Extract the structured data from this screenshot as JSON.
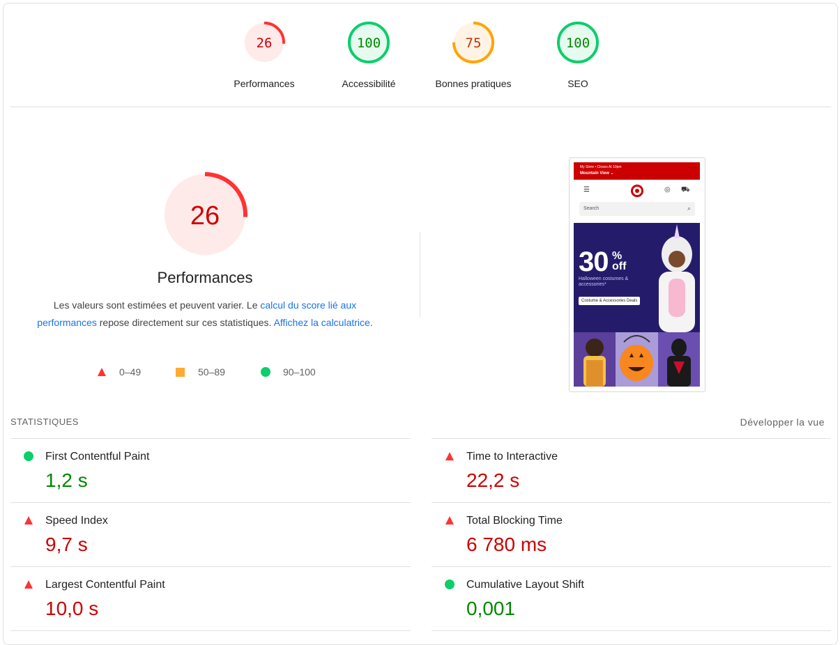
{
  "categories": [
    {
      "score": "26",
      "label": "Performances",
      "fraction": 0.26,
      "status": "fail"
    },
    {
      "score": "100",
      "label": "Accessibilité",
      "fraction": 1.0,
      "status": "pass"
    },
    {
      "score": "75",
      "label": "Bonnes pratiques",
      "fraction": 0.75,
      "status": "average"
    },
    {
      "score": "100",
      "label": "SEO",
      "fraction": 1.0,
      "status": "pass"
    }
  ],
  "performance": {
    "score": "26",
    "fraction": 0.26,
    "title": "Performances",
    "desc_pre": "Les valeurs sont estimées et peuvent varier. Le ",
    "desc_link1": "calcul du score lié aux performances",
    "desc_mid": " repose directement sur ces statistiques. ",
    "desc_link2": "Affichez la calculatrice",
    "desc_post": "."
  },
  "legend": [
    {
      "shape": "triangle",
      "color": "#ff3333",
      "range": "0–49"
    },
    {
      "shape": "square",
      "color": "#ffaa33",
      "range": "50–89"
    },
    {
      "shape": "circle",
      "color": "#0cce6b",
      "range": "90–100"
    }
  ],
  "screenshot": {
    "store_line": "My Store • Closes At 10pm",
    "store_name": "Mountain View ⌄",
    "search_placeholder": "Search",
    "hero_number": "30",
    "hero_pct": "%",
    "hero_off": "off",
    "hero_sub": "Halloween costumes & accessories*",
    "hero_button": "Costume & Accessories Deals"
  },
  "stats": {
    "heading": "STATISTIQUES",
    "expand": "Développer la vue",
    "metrics": [
      {
        "name": "First Contentful Paint",
        "value": "1,2 s",
        "status": "pass"
      },
      {
        "name": "Time to Interactive",
        "value": "22,2 s",
        "status": "fail"
      },
      {
        "name": "Speed Index",
        "value": "9,7 s",
        "status": "fail"
      },
      {
        "name": "Total Blocking Time",
        "value": "6 780 ms",
        "status": "fail"
      },
      {
        "name": "Largest Contentful Paint",
        "value": "10,0 s",
        "status": "fail"
      },
      {
        "name": "Cumulative Layout Shift",
        "value": "0,001",
        "status": "pass"
      }
    ]
  },
  "colors": {
    "fail": "#ff3333",
    "fail_text": "#cc0000",
    "fail_bg": "#ffeaea",
    "average": "#ffa400",
    "average_text": "#c33300",
    "average_bg": "#fff3e6",
    "pass": "#0cce6b",
    "pass_text": "#008800",
    "pass_bg": "#e6faef"
  }
}
